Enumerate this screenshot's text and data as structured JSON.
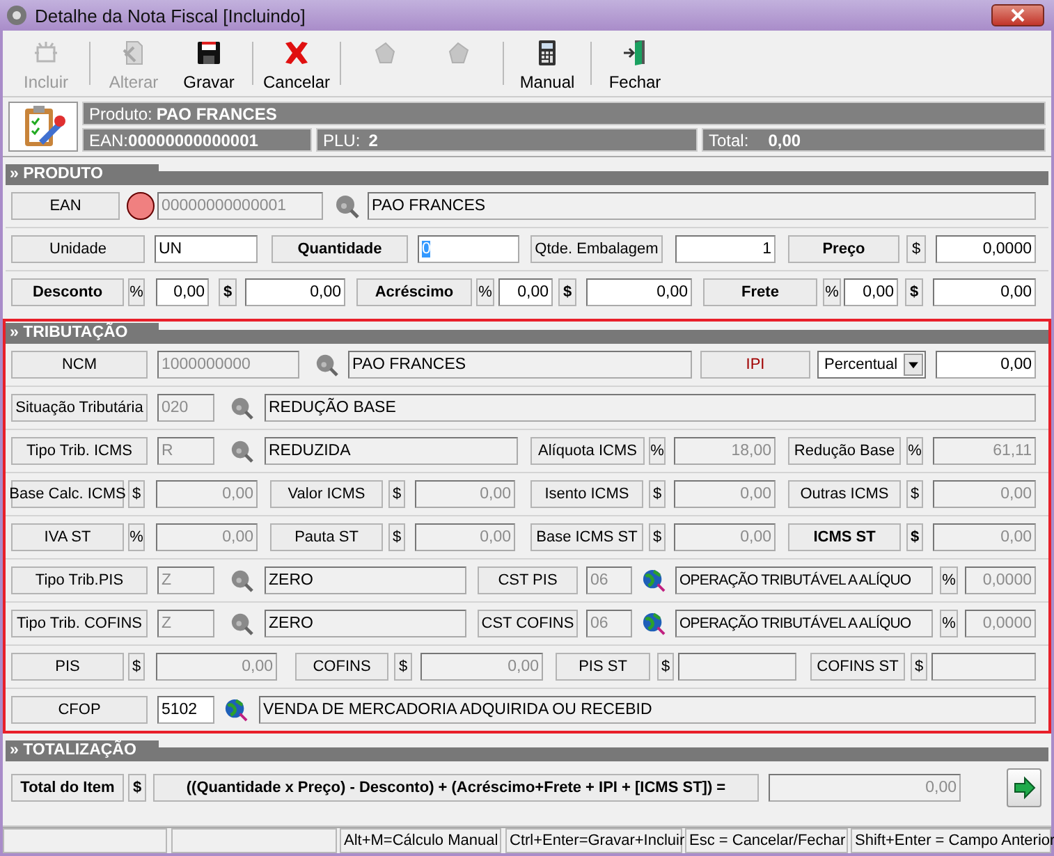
{
  "window": {
    "title": "Detalhe da Nota Fiscal [Incluindo]"
  },
  "toolbar": [
    {
      "kind": "new",
      "label": "Incluir",
      "disabled": true
    },
    {
      "kind": "edit",
      "label": "Alterar",
      "disabled": true
    },
    {
      "kind": "save",
      "label": "Gravar",
      "disabled": false
    },
    {
      "kind": "cancel",
      "label": "Cancelar",
      "disabled": false
    },
    {
      "kind": "bucket-left",
      "disabled": true
    },
    {
      "kind": "bucket-right",
      "disabled": true
    },
    {
      "kind": "calculator",
      "label": "Manual",
      "disabled": false
    },
    {
      "kind": "exit",
      "label": "Fechar",
      "disabled": false
    }
  ],
  "product_info": {
    "product_label": "Produto:",
    "product": "PAO FRANCES",
    "ean_label": "EAN:",
    "ean": "00000000000001",
    "plu_label": "PLU:",
    "plu": "2",
    "total_label": "Total:",
    "total": "0,00"
  },
  "sections": [
    {
      "title": "» PRODUTO",
      "highlighted": false,
      "lines": [
        {
          "controls": [
            {
              "kind": "label",
              "text": "EAN",
              "bold": false
            },
            {
              "kind": "dot",
              "color": "#f08080"
            },
            {
              "kind": "field",
              "value": "00000000000001",
              "editable": false,
              "disabled": true,
              "numeric": false
            },
            {
              "kind": "lookup"
            },
            {
              "kind": "field",
              "value": "PAO FRANCES",
              "editable": false,
              "disabled": false,
              "numeric": false
            }
          ]
        },
        {
          "controls": [
            {
              "kind": "label",
              "text": "Unidade",
              "bold": false
            },
            {
              "kind": "field",
              "value": "UN",
              "editable": true,
              "disabled": false,
              "numeric": false
            },
            {
              "kind": "label",
              "text": "Quantidade",
              "bold": true
            },
            {
              "kind": "field",
              "value": "0",
              "editable": true,
              "disabled": false,
              "numeric": false,
              "highlighted": true
            },
            {
              "kind": "label",
              "text": "Qtde. Embalagem",
              "bold": false
            },
            {
              "kind": "field",
              "value": "1",
              "editable": true,
              "disabled": false,
              "numeric": true
            },
            {
              "kind": "label",
              "text": "Preço",
              "bold": true
            },
            {
              "kind": "unit",
              "text": "$",
              "bold": false
            },
            {
              "kind": "field",
              "value": "0,0000",
              "editable": true,
              "disabled": false,
              "numeric": true
            }
          ]
        },
        {
          "controls": [
            {
              "kind": "label",
              "text": "Desconto",
              "bold": true
            },
            {
              "kind": "unit",
              "text": "%",
              "bold": false
            },
            {
              "kind": "field",
              "value": "0,00",
              "editable": true,
              "disabled": false,
              "numeric": true
            },
            {
              "kind": "unit",
              "text": "$",
              "bold": true
            },
            {
              "kind": "field",
              "value": "0,00",
              "editable": true,
              "disabled": false,
              "numeric": true
            },
            {
              "kind": "label",
              "text": "Acréscimo",
              "bold": true
            },
            {
              "kind": "unit",
              "text": "%",
              "bold": false
            },
            {
              "kind": "field",
              "value": "0,00",
              "editable": true,
              "disabled": false,
              "numeric": true
            },
            {
              "kind": "unit",
              "text": "$",
              "bold": true
            },
            {
              "kind": "field",
              "value": "0,00",
              "editable": true,
              "disabled": false,
              "numeric": true
            },
            {
              "kind": "label",
              "text": "Frete",
              "bold": true
            },
            {
              "kind": "unit",
              "text": "%",
              "bold": false
            },
            {
              "kind": "field",
              "value": "0,00",
              "editable": true,
              "disabled": false,
              "numeric": true
            },
            {
              "kind": "unit",
              "text": "$",
              "bold": true
            },
            {
              "kind": "field",
              "value": "0,00",
              "editable": true,
              "disabled": false,
              "numeric": true
            }
          ]
        }
      ]
    },
    {
      "title": "» TRIBUTAÇÃO",
      "highlighted": true,
      "lines": [
        {
          "controls": [
            {
              "kind": "label",
              "text": "NCM",
              "bold": false
            },
            {
              "kind": "field",
              "value": "1000000000",
              "editable": false,
              "disabled": true,
              "numeric": false
            },
            {
              "kind": "lookup"
            },
            {
              "kind": "field",
              "value": "PAO FRANCES",
              "editable": false,
              "disabled": false,
              "numeric": false
            },
            {
              "kind": "label",
              "text": "IPI",
              "bold": false,
              "color": "#a00000"
            },
            {
              "kind": "select",
              "value": "Percentual"
            },
            {
              "kind": "field",
              "value": "0,00",
              "editable": true,
              "disabled": false,
              "numeric": true
            }
          ]
        },
        {
          "controls": [
            {
              "kind": "label",
              "text": "Situação Tributária",
              "bold": false
            },
            {
              "kind": "field",
              "value": "020",
              "editable": false,
              "disabled": true,
              "numeric": false
            },
            {
              "kind": "lookup"
            },
            {
              "kind": "field",
              "value": "REDUÇÃO BASE",
              "editable": false,
              "disabled": false,
              "numeric": false
            }
          ]
        },
        {
          "controls": [
            {
              "kind": "label",
              "text": "Tipo Trib. ICMS",
              "bold": false
            },
            {
              "kind": "field",
              "value": "R",
              "editable": false,
              "disabled": true,
              "numeric": false
            },
            {
              "kind": "lookup"
            },
            {
              "kind": "field",
              "value": "REDUZIDA",
              "editable": false,
              "disabled": false,
              "numeric": false
            },
            {
              "kind": "label",
              "text": "Alíquota ICMS",
              "bold": false
            },
            {
              "kind": "unit",
              "text": "%",
              "bold": false
            },
            {
              "kind": "field",
              "value": "18,00",
              "editable": false,
              "disabled": true,
              "numeric": true
            },
            {
              "kind": "label",
              "text": "Redução Base",
              "bold": false
            },
            {
              "kind": "unit",
              "text": "%",
              "bold": false
            },
            {
              "kind": "field",
              "value": "61,11",
              "editable": false,
              "disabled": true,
              "numeric": true
            }
          ]
        },
        {
          "controls": [
            {
              "kind": "label",
              "text": "Base Calc. ICMS",
              "bold": false
            },
            {
              "kind": "unit",
              "text": "$",
              "bold": false
            },
            {
              "kind": "field",
              "value": "0,00",
              "editable": false,
              "disabled": true,
              "numeric": true
            },
            {
              "kind": "label",
              "text": "Valor ICMS",
              "bold": false
            },
            {
              "kind": "unit",
              "text": "$",
              "bold": false
            },
            {
              "kind": "field",
              "value": "0,00",
              "editable": false,
              "disabled": true,
              "numeric": true
            },
            {
              "kind": "label",
              "text": "Isento ICMS",
              "bold": false
            },
            {
              "kind": "unit",
              "text": "$",
              "bold": false
            },
            {
              "kind": "field",
              "value": "0,00",
              "editable": false,
              "disabled": true,
              "numeric": true
            },
            {
              "kind": "label",
              "text": "Outras ICMS",
              "bold": false
            },
            {
              "kind": "unit",
              "text": "$",
              "bold": false
            },
            {
              "kind": "field",
              "value": "0,00",
              "editable": false,
              "disabled": true,
              "numeric": true
            }
          ]
        },
        {
          "controls": [
            {
              "kind": "label",
              "text": "IVA ST",
              "bold": false
            },
            {
              "kind": "unit",
              "text": "%",
              "bold": false
            },
            {
              "kind": "field",
              "value": "0,00",
              "editable": false,
              "disabled": true,
              "numeric": true
            },
            {
              "kind": "label",
              "text": "Pauta ST",
              "bold": false
            },
            {
              "kind": "unit",
              "text": "$",
              "bold": false
            },
            {
              "kind": "field",
              "value": "0,00",
              "editable": false,
              "disabled": true,
              "numeric": true
            },
            {
              "kind": "label",
              "text": "Base ICMS ST",
              "bold": false
            },
            {
              "kind": "unit",
              "text": "$",
              "bold": false
            },
            {
              "kind": "field",
              "value": "0,00",
              "editable": false,
              "disabled": true,
              "numeric": true
            },
            {
              "kind": "label",
              "text": "ICMS ST",
              "bold": true
            },
            {
              "kind": "unit",
              "text": "$",
              "bold": true
            },
            {
              "kind": "field",
              "value": "0,00",
              "editable": false,
              "disabled": true,
              "numeric": true
            }
          ]
        },
        {
          "controls": [
            {
              "kind": "label",
              "text": "Tipo Trib.PIS",
              "bold": false
            },
            {
              "kind": "field",
              "value": "Z",
              "editable": false,
              "disabled": true,
              "numeric": false
            },
            {
              "kind": "lookup"
            },
            {
              "kind": "field",
              "value": "ZERO",
              "editable": false,
              "disabled": false,
              "numeric": false
            },
            {
              "kind": "label",
              "text": "CST PIS",
              "bold": false
            },
            {
              "kind": "field",
              "value": "06",
              "editable": false,
              "disabled": true,
              "numeric": false
            },
            {
              "kind": "globe"
            },
            {
              "kind": "field",
              "value": "OPERAÇÃO TRIBUTÁVEL A ALÍQUO",
              "editable": false,
              "disabled": false,
              "numeric": false
            },
            {
              "kind": "unit",
              "text": "%",
              "bold": false
            },
            {
              "kind": "field",
              "value": "0,0000",
              "editable": false,
              "disabled": true,
              "numeric": true
            }
          ]
        },
        {
          "controls": [
            {
              "kind": "label",
              "text": "Tipo Trib. COFINS",
              "bold": false
            },
            {
              "kind": "field",
              "value": "Z",
              "editable": false,
              "disabled": true,
              "numeric": false
            },
            {
              "kind": "lookup"
            },
            {
              "kind": "field",
              "value": "ZERO",
              "editable": false,
              "disabled": false,
              "numeric": false
            },
            {
              "kind": "label",
              "text": "CST COFINS",
              "bold": false
            },
            {
              "kind": "field",
              "value": "06",
              "editable": false,
              "disabled": true,
              "numeric": false
            },
            {
              "kind": "globe"
            },
            {
              "kind": "field",
              "value": "OPERAÇÃO TRIBUTÁVEL A ALÍQUO",
              "editable": false,
              "disabled": false,
              "numeric": false
            },
            {
              "kind": "unit",
              "text": "%",
              "bold": false
            },
            {
              "kind": "field",
              "value": "0,0000",
              "editable": false,
              "disabled": true,
              "numeric": true
            }
          ]
        },
        {
          "controls": [
            {
              "kind": "label",
              "text": "PIS",
              "bold": false
            },
            {
              "kind": "unit",
              "text": "$",
              "bold": false
            },
            {
              "kind": "field",
              "value": "0,00",
              "editable": false,
              "disabled": true,
              "numeric": true
            },
            {
              "kind": "label",
              "text": "COFINS",
              "bold": false
            },
            {
              "kind": "unit",
              "text": "$",
              "bold": false
            },
            {
              "kind": "field",
              "value": "0,00",
              "editable": false,
              "disabled": true,
              "numeric": true
            },
            {
              "kind": "label",
              "text": "PIS ST",
              "bold": false
            },
            {
              "kind": "unit",
              "text": "$",
              "bold": false
            },
            {
              "kind": "field",
              "editable": false
            },
            {
              "kind": "label",
              "text": "COFINS ST",
              "bold": false
            },
            {
              "kind": "unit",
              "text": "$",
              "bold": false
            },
            {
              "kind": "field",
              "editable": false
            }
          ]
        },
        {
          "controls": [
            {
              "kind": "label",
              "text": "CFOP",
              "bold": false
            },
            {
              "kind": "field",
              "value": "5102",
              "editable": true,
              "disabled": false,
              "numeric": false
            },
            {
              "kind": "globe"
            },
            {
              "kind": "field",
              "value": "VENDA DE MERCADORIA ADQUIRIDA OU RECEBID",
              "editable": false,
              "disabled": false,
              "numeric": false
            }
          ]
        }
      ]
    },
    {
      "title": "» TOTALIZAÇÃO",
      "highlighted": false,
      "lines": [
        {
          "controls": [
            {
              "kind": "label",
              "text": "Total do Item",
              "bold": true
            },
            {
              "kind": "unit",
              "text": "$",
              "bold": true
            },
            {
              "kind": "label",
              "text": "((Quantidade x Preço) - Desconto) + (Acréscimo+Frete + IPI + [ICMS ST]) =",
              "bold": true
            },
            {
              "kind": "field",
              "value": "0,00",
              "editable": false,
              "disabled": true,
              "numeric": true
            },
            {
              "kind": "button"
            }
          ]
        }
      ]
    }
  ],
  "status_bar": [
    "Alt+M=Cálculo Manual",
    "Ctrl+Enter=Gravar+Incluir",
    "Esc = Cancelar/Fechar",
    "Shift+Enter = Campo Anterior"
  ]
}
